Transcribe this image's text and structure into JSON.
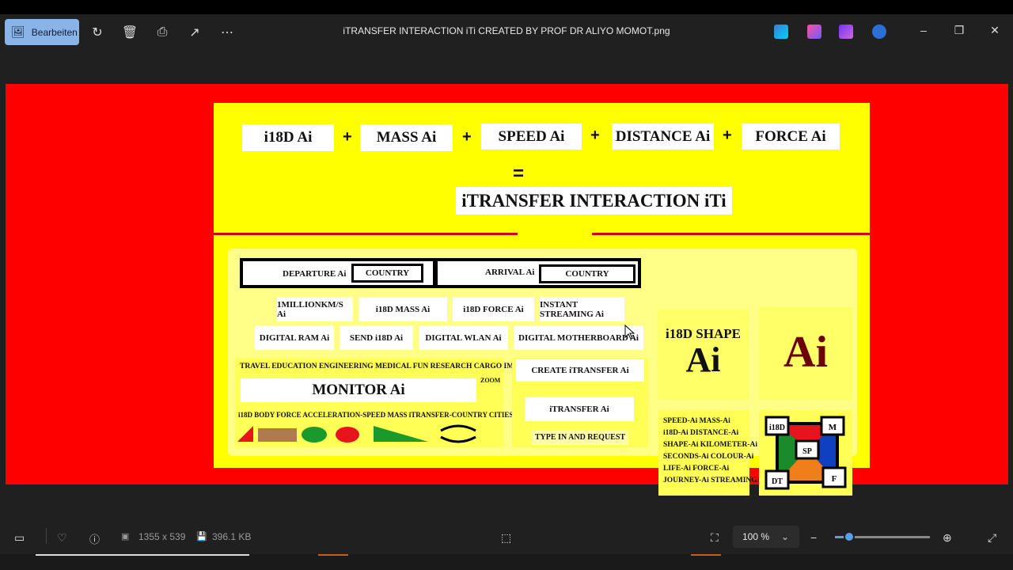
{
  "titlebar": {
    "edit_label": "Bearbeiten",
    "window_title": "iTRANSFER  INTERACTION   iTi    CREATED BY PROF  DR  ALIYO MOMOT.png"
  },
  "image": {
    "equation": {
      "terms": [
        "i18D  Ai",
        "MASS  Ai",
        "SPEED Ai",
        "DISTANCE Ai",
        "FORCE  Ai"
      ],
      "plus": "+",
      "equals": "=",
      "result": "iTRANSFER  INTERACTION   iTi"
    },
    "departure_label": "DEPARTURE  Ai",
    "departure_country": "COUNTRY",
    "arrival_label": "ARRIVAL Ai",
    "arrival_country": "COUNTRY",
    "row2": [
      "1MILLIONKM/S  Ai",
      "i18D MASS   Ai",
      "i18D FORCE Ai",
      "INSTANT STREAMING Ai"
    ],
    "row3": [
      "DIGITAL RAM   Ai",
      "SEND i18D Ai",
      "DIGITAL WLAN  Ai",
      "DIGITAL MOTHERBOARD  Ai"
    ],
    "categories": "TRAVEL  EDUCATION  ENGINEERING  MEDICAL  FUN  RESEARCH  CARGO IMMIGRATION-Ai",
    "zoom": "ZOOM",
    "monitor": "MONITOR Ai",
    "keywords": "i18D  BODY  FORCE  ACCELERATION-SPEED  MASS  iTRANSFER-COUNTRY  CITIES  LIVE-Ai",
    "create": "CREATE iTRANSFER  Ai",
    "itransfer": "iTRANSFER Ai",
    "type_request": "TYPE IN AND REQUEST",
    "shape_title": "i18D SHAPE",
    "shape_ai": "Ai",
    "big_ai": "Ai",
    "list": [
      "SPEED-Ai  MASS-Ai",
      "i18D-Ai  DISTANCE-Ai",
      "SHAPE-Ai  KILOMETER-Ai",
      "SECONDS-Ai  COLOUR-Ai",
      "LIFE-Ai FORCE-Ai",
      "JOURNEY-Ai STREAMINGAi"
    ],
    "diagram": {
      "tl": "i18D",
      "tr": "M",
      "center": "SP",
      "bl": "DT",
      "br": "F"
    }
  },
  "statusbar": {
    "dimensions": "1355 x 539",
    "filesize": "396.1 KB",
    "zoom": "100 %",
    "zoom_fraction": 0.15
  }
}
